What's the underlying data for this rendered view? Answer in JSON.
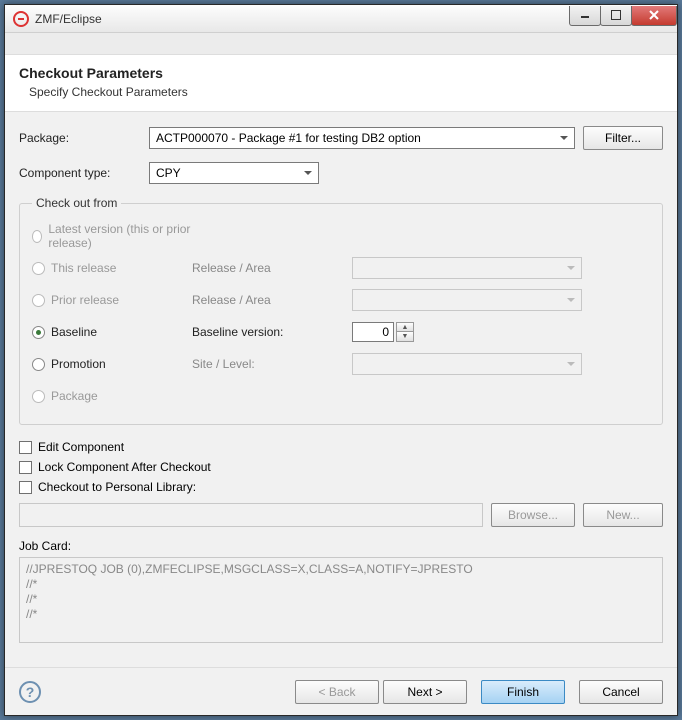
{
  "window": {
    "title": "ZMF/Eclipse"
  },
  "header": {
    "title": "Checkout Parameters",
    "subtitle": "Specify Checkout Parameters"
  },
  "labels": {
    "package": "Package:",
    "component_type": "Component type:",
    "filter": "Filter...",
    "checkout_from": "Check out from",
    "latest_version": "Latest version (this or prior release)",
    "this_release": "This release",
    "prior_release": "Prior release",
    "baseline": "Baseline",
    "promotion": "Promotion",
    "package_radio": "Package",
    "release_area": "Release / Area",
    "baseline_version": "Baseline version:",
    "site_level": "Site / Level:",
    "edit_component": "Edit Component",
    "lock_component": "Lock Component After Checkout",
    "checkout_personal": "Checkout to Personal Library:",
    "browse": "Browse...",
    "new": "New...",
    "job_card": "Job Card:"
  },
  "values": {
    "package": "ACTP000070 - Package #1 for testing DB2 option",
    "component_type": "CPY",
    "baseline_version": "0",
    "job_card": "//JPRESTOQ JOB (0),ZMFECLIPSE,MSGCLASS=X,CLASS=A,NOTIFY=JPRESTO\n//*\n//*\n//*"
  },
  "footer": {
    "back": "< Back",
    "next": "Next >",
    "finish": "Finish",
    "cancel": "Cancel"
  }
}
